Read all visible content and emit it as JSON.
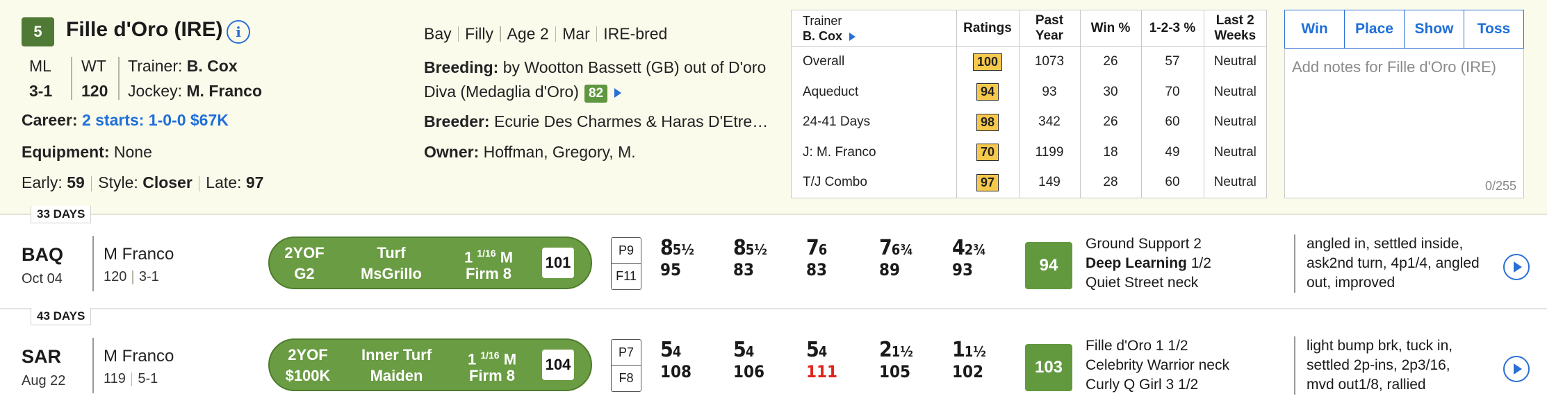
{
  "horse": {
    "program_number": "5",
    "name": "Fille d'Oro (IRE)",
    "ml_label": "ML",
    "ml_value": "3-1",
    "wt_label": "WT",
    "wt_value": "120",
    "trainer_label": "Trainer:",
    "trainer": "B. Cox",
    "jockey_label": "Jockey:",
    "jockey": "M. Franco",
    "career_label": "Career:",
    "career": "2 starts: 1-0-0 $67K",
    "equipment_label": "Equipment:",
    "equipment": "None",
    "early_label": "Early:",
    "early": "59",
    "style_label": "Style:",
    "style": "Closer",
    "late_label": "Late:",
    "late": "97",
    "color": "Bay",
    "sex": "Filly",
    "age": "Age 2",
    "foal_month": "Mar",
    "bred": "IRE-bred",
    "breeding_label": "Breeding:",
    "breeding_line1": "by Wootton Bassett (GB) out of D'oro",
    "breeding_line2": "Diva (Medaglia d'Oro)",
    "breeding_rating": "82",
    "breeder_label": "Breeder:",
    "breeder": "Ecurie Des Charmes & Haras D'Etre…",
    "owner_label": "Owner:",
    "owner": "Hoffman, Gregory, M."
  },
  "stats": {
    "trainer_header": "Trainer",
    "trainer_name": "B. Cox",
    "columns": [
      "Ratings",
      "Past Year",
      "Win %",
      "1-2-3 %",
      "Last 2 Weeks"
    ],
    "rows": [
      {
        "label": "Overall",
        "rating": "100",
        "past": "1073",
        "win": "26",
        "itm": "57",
        "trend": "Neutral"
      },
      {
        "label": "Aqueduct",
        "rating": "94",
        "past": "93",
        "win": "30",
        "itm": "70",
        "trend": "Neutral"
      },
      {
        "label": "24-41 Days",
        "rating": "98",
        "past": "342",
        "win": "26",
        "itm": "60",
        "trend": "Neutral"
      },
      {
        "label": "J: M. Franco",
        "rating": "70",
        "past": "1199",
        "win": "18",
        "itm": "49",
        "trend": "Neutral"
      },
      {
        "label": "T/J Combo",
        "rating": "97",
        "past": "149",
        "win": "28",
        "itm": "60",
        "trend": "Neutral"
      }
    ]
  },
  "bets": {
    "win": "Win",
    "place": "Place",
    "show": "Show",
    "toss": "Toss"
  },
  "notes": {
    "placeholder": "Add notes for Fille d'Oro (IRE)",
    "counter": "0/255"
  },
  "races": [
    {
      "days": "33 DAYS",
      "track": "BAQ",
      "date": "Oct 04",
      "jockey": "M Franco",
      "weight": "120",
      "odds": "3-1",
      "age_sex": "2YOF",
      "class": "G2",
      "surface": "Turf",
      "race_name": "MsGrillo",
      "distance_whole": "1",
      "distance_frac": "1/16",
      "distance_unit": "M",
      "condition": "Firm 8",
      "race_rating": "101",
      "post": "P9",
      "field": "F11",
      "calls": [
        {
          "pos": "8",
          "len": "5½",
          "fig": "95",
          "red": false
        },
        {
          "pos": "8",
          "len": "5½",
          "fig": "83",
          "red": false
        },
        {
          "pos": "7",
          "len": "6",
          "fig": "83",
          "red": false
        },
        {
          "pos": "7",
          "len": "6¾",
          "fig": "89",
          "red": false
        },
        {
          "pos": "4",
          "len": "2¾",
          "fig": "93",
          "red": false
        }
      ],
      "speed": "94",
      "finishers": [
        {
          "name": "Ground Support",
          "margin": "2",
          "bold": false
        },
        {
          "name": "Deep Learning",
          "margin": "1/2",
          "bold": true
        },
        {
          "name": "Quiet Street",
          "margin": "neck",
          "bold": false
        }
      ],
      "comment": [
        "angled in, settled inside,",
        "ask2nd turn, 4p1/4, angled",
        "out, improved"
      ]
    },
    {
      "days": "43 DAYS",
      "track": "SAR",
      "date": "Aug 22",
      "jockey": "M Franco",
      "weight": "119",
      "odds": "5-1",
      "age_sex": "2YOF",
      "class": "$100K",
      "surface": "Inner Turf",
      "race_name": "Maiden",
      "distance_whole": "1",
      "distance_frac": "1/16",
      "distance_unit": "M",
      "condition": "Firm 8",
      "race_rating": "104",
      "post": "P7",
      "field": "F8",
      "calls": [
        {
          "pos": "5",
          "len": "4",
          "fig": "108",
          "red": false
        },
        {
          "pos": "5",
          "len": "4",
          "fig": "106",
          "red": false
        },
        {
          "pos": "5",
          "len": "4",
          "fig": "111",
          "red": true
        },
        {
          "pos": "2",
          "len": "1½",
          "fig": "105",
          "red": false
        },
        {
          "pos": "1",
          "len": "1½",
          "fig": "102",
          "red": false
        }
      ],
      "speed": "103",
      "finishers": [
        {
          "name": "Fille d'Oro",
          "margin": "1 1/2",
          "bold": false
        },
        {
          "name": "Celebrity Warrior",
          "margin": "neck",
          "bold": false
        },
        {
          "name": "Curly Q Girl",
          "margin": "3 1/2",
          "bold": false
        }
      ],
      "comment": [
        "light bump brk, tuck in,",
        "settled 2p-ins, 2p3/16,",
        "mvd out1/8, rallied"
      ]
    }
  ],
  "colors": {
    "accent": "#2a6fd6",
    "rating_green": "#6a9c43",
    "rating_box": "#f6c94c",
    "alert_red": "#e0241b"
  },
  "icons": {
    "info": "info-icon",
    "expand": "triangle-right-icon",
    "play": "play-circle-icon"
  }
}
